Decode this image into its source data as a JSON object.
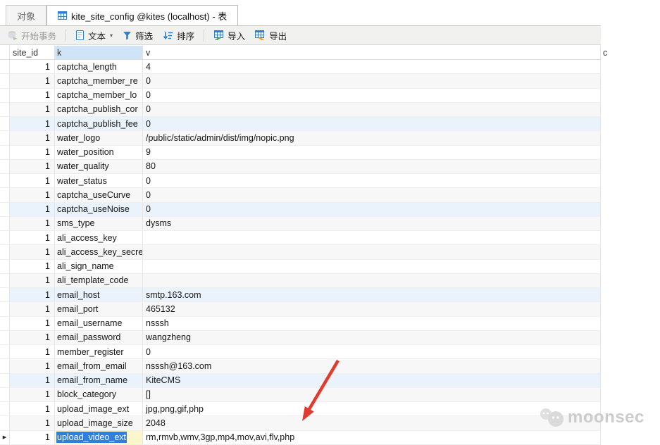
{
  "tabs": {
    "objects": "对象",
    "table": "kite_site_config @kites (localhost) - 表"
  },
  "toolbar": {
    "begin_transaction": "开始事务",
    "text": "文本",
    "text_caret": "▾",
    "filter": "筛选",
    "sort": "排序",
    "import_btn": "导入",
    "export_btn": "导出"
  },
  "grid": {
    "columns": {
      "site_id": "site_id",
      "k": "k",
      "v": "v",
      "clipped": "c"
    },
    "rows": [
      [
        "1",
        "captcha_length",
        "4"
      ],
      [
        "1",
        "captcha_member_re",
        "0"
      ],
      [
        "1",
        "captcha_member_lo",
        "0"
      ],
      [
        "1",
        "captcha_publish_cor",
        "0"
      ],
      [
        "1",
        "captcha_publish_fee",
        "0"
      ],
      [
        "1",
        "water_logo",
        "/public/static/admin/dist/img/nopic.png"
      ],
      [
        "1",
        "water_position",
        "9"
      ],
      [
        "1",
        "water_quality",
        "80"
      ],
      [
        "1",
        "water_status",
        "0"
      ],
      [
        "1",
        "captcha_useCurve",
        "0"
      ],
      [
        "1",
        "captcha_useNoise",
        "0"
      ],
      [
        "1",
        "sms_type",
        "dysms"
      ],
      [
        "1",
        "ali_access_key",
        ""
      ],
      [
        "1",
        "ali_access_key_secre",
        ""
      ],
      [
        "1",
        "ali_sign_name",
        ""
      ],
      [
        "1",
        "ali_template_code",
        ""
      ],
      [
        "1",
        "email_host",
        "smtp.163.com"
      ],
      [
        "1",
        "email_port",
        "465132"
      ],
      [
        "1",
        "email_username",
        "nsssh"
      ],
      [
        "1",
        "email_password",
        "wangzheng"
      ],
      [
        "1",
        "member_register",
        "0"
      ],
      [
        "1",
        "email_from_email",
        "nsssh@163.com"
      ],
      [
        "1",
        "email_from_name",
        "KiteCMS"
      ],
      [
        "1",
        "block_category",
        "[]"
      ],
      [
        "1",
        "upload_image_ext",
        "jpg,png,gif,php"
      ],
      [
        "1",
        "upload_image_size",
        "2048"
      ],
      [
        "1",
        "upload_video_ext",
        "rm,rmvb,wmv,3gp,mp4,mov,avi,flv,php"
      ]
    ],
    "highlighted_row_indexes": [
      5,
      11,
      17,
      23
    ],
    "selected_cell": {
      "row": 27,
      "column": "k",
      "text": "upload_video_ext"
    },
    "row_marker": "▶"
  },
  "watermark": {
    "text": "moonsec"
  },
  "colors": {
    "selection_blue": "#2f7fe0",
    "edit_cell_yellow": "#fcf6cd",
    "selected_column_header": "#cfe4f7",
    "row_stripe_gray": "#f7f7f7",
    "row_stripe_blue": "#eaf3fb",
    "arrow_red": "#e23a2c",
    "watermark_gray": "#cccccc",
    "toolbar_icon_blue": "#2e7fd0"
  }
}
